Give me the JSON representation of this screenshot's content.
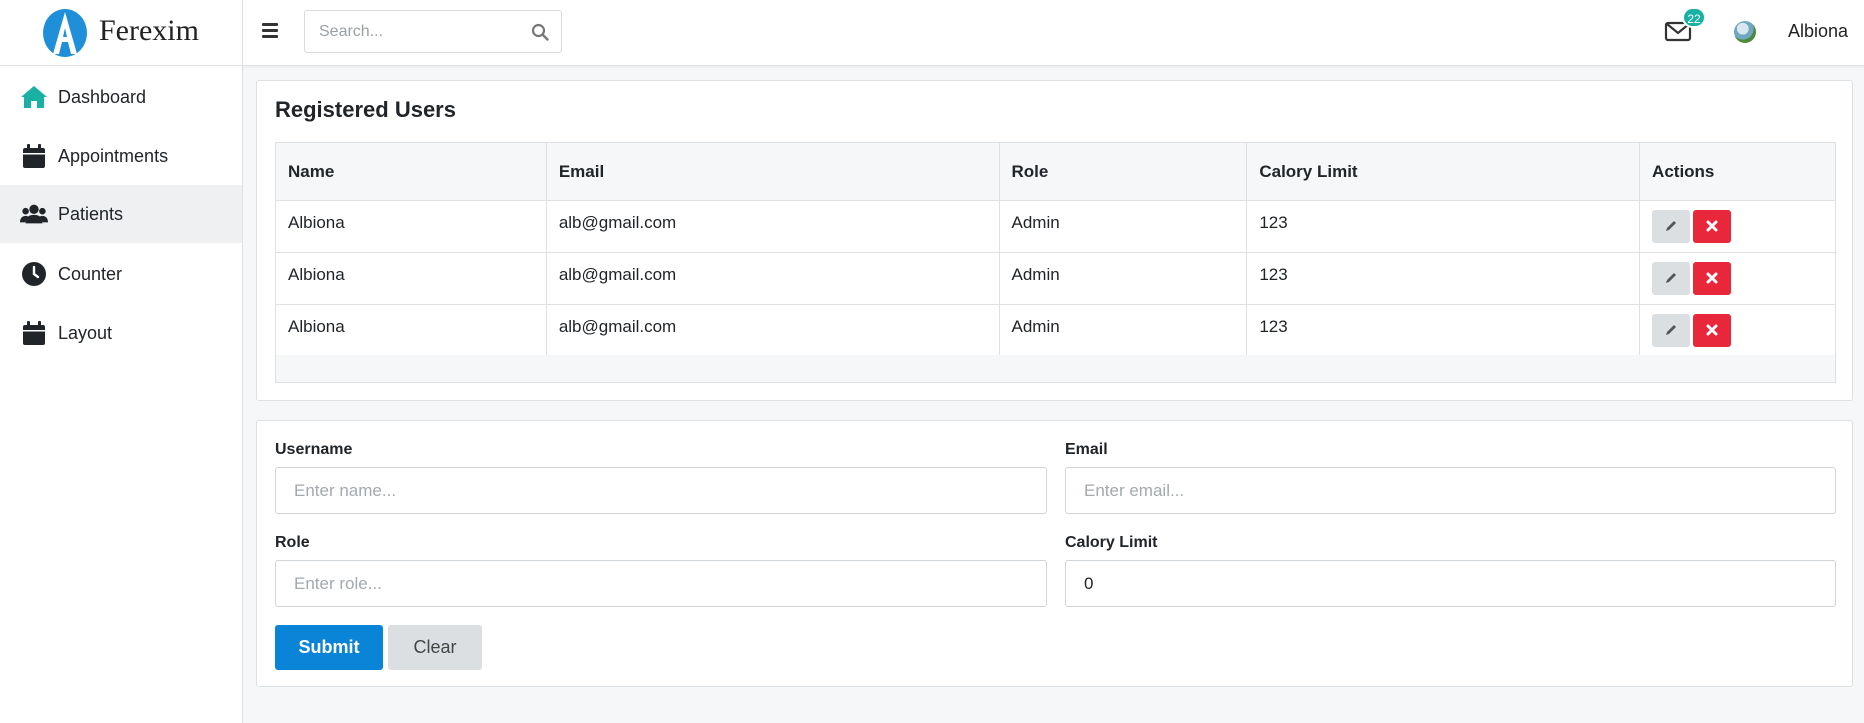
{
  "brand": {
    "name": "Ferexim",
    "logo_icon": "ferexim-logo"
  },
  "header": {
    "search_placeholder": "Search...",
    "mail_badge": "22",
    "user_name": "Albiona"
  },
  "sidebar": {
    "items": [
      {
        "label": "Dashboard",
        "icon": "home-icon"
      },
      {
        "label": "Appointments",
        "icon": "calendar-icon"
      },
      {
        "label": "Patients",
        "icon": "users-icon"
      },
      {
        "label": "Counter",
        "icon": "clock-icon"
      },
      {
        "label": "Layout",
        "icon": "calendar-icon"
      }
    ],
    "active": "Patients"
  },
  "users_card": {
    "title": "Registered Users",
    "columns": [
      "Name",
      "Email",
      "Role",
      "Calory Limit",
      "Actions"
    ],
    "rows": [
      {
        "name": "Albiona",
        "email": "alb@gmail.com",
        "role": "Admin",
        "calory_limit": "123"
      },
      {
        "name": "Albiona",
        "email": "alb@gmail.com",
        "role": "Admin",
        "calory_limit": "123"
      },
      {
        "name": "Albiona",
        "email": "alb@gmail.com",
        "role": "Admin",
        "calory_limit": "123"
      }
    ]
  },
  "form": {
    "username_label": "Username",
    "username_placeholder": "Enter name...",
    "email_label": "Email",
    "email_placeholder": "Enter email...",
    "role_label": "Role",
    "role_placeholder": "Enter role...",
    "calory_label": "Calory Limit",
    "calory_value": "0",
    "submit_label": "Submit",
    "clear_label": "Clear"
  },
  "colors": {
    "accent": "#19b1a4",
    "primary": "#0a84d6",
    "danger": "#e8283a",
    "logo": "#1e8fd8"
  }
}
